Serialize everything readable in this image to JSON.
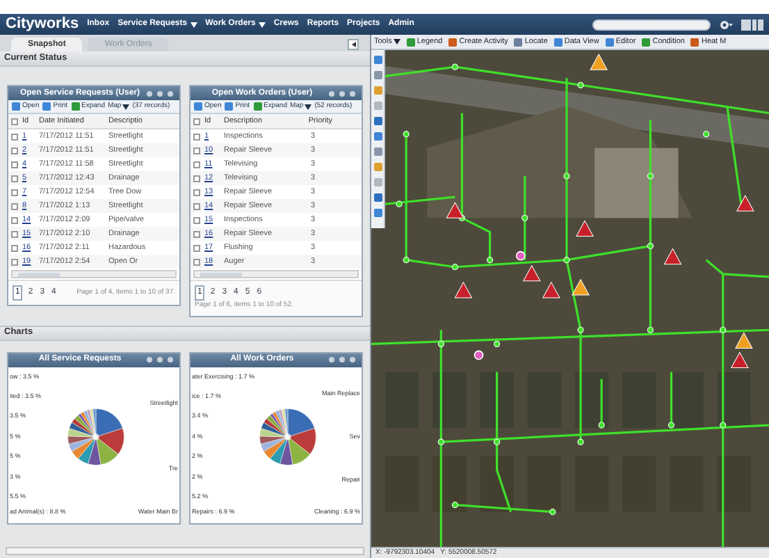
{
  "app": {
    "logo": "Cityworks",
    "nav": [
      {
        "label": "Inbox",
        "dropdown": false
      },
      {
        "label": "Service Requests",
        "dropdown": true
      },
      {
        "label": "Work Orders",
        "dropdown": true
      },
      {
        "label": "Crews",
        "dropdown": false
      },
      {
        "label": "Reports",
        "dropdown": false
      },
      {
        "label": "Projects",
        "dropdown": false
      },
      {
        "label": "Admin",
        "dropdown": false
      }
    ]
  },
  "tabs": [
    {
      "label": "Snapshot",
      "selected": true
    },
    {
      "label": "Work Orders",
      "selected": false
    }
  ],
  "current_status": {
    "title": "Current Status",
    "widgets": [
      {
        "title": "Open Service Requests (User)",
        "header_checked": false,
        "toolbar": [
          "Open",
          "Print",
          "Expand",
          "Map"
        ],
        "records": "(37 records)",
        "columns": [
          "Id",
          "Date Initiated",
          "Descriptio"
        ],
        "rows": [
          {
            "checked": false,
            "cells": [
              "1",
              "7/17/2012 11:51",
              "Streetlight"
            ]
          },
          {
            "checked": false,
            "cells": [
              "2",
              "7/17/2012 11:51",
              "Streetlight"
            ]
          },
          {
            "checked": false,
            "cells": [
              "4",
              "7/17/2012 11:58",
              "Streetlight"
            ]
          },
          {
            "checked": false,
            "cells": [
              "5",
              "7/17/2012 12:43",
              "Drainage"
            ]
          },
          {
            "checked": false,
            "cells": [
              "7",
              "7/17/2012 12:54",
              "Tree Dow"
            ]
          },
          {
            "checked": false,
            "cells": [
              "8",
              "7/17/2012 1:13",
              "Streetlight"
            ]
          },
          {
            "checked": false,
            "cells": [
              "14",
              "7/17/2012 2:09",
              "Pipe/valve"
            ]
          },
          {
            "checked": false,
            "cells": [
              "15",
              "7/17/2012 2:10",
              "Drainage"
            ]
          },
          {
            "checked": false,
            "cells": [
              "16",
              "7/17/2012 2:11",
              "Hazardous"
            ]
          },
          {
            "checked": false,
            "cells": [
              "19",
              "7/17/2012 2:54",
              "Open Or"
            ]
          }
        ],
        "pages": [
          {
            "label": "1",
            "selected": true
          },
          {
            "label": "2",
            "selected": false
          },
          {
            "label": "3",
            "selected": false
          },
          {
            "label": "4",
            "selected": false
          }
        ],
        "page_info": "Page 1 of 4, items 1 to 10 of 37."
      },
      {
        "title": "Open Work Orders (User)",
        "header_checked": false,
        "toolbar": [
          "Open",
          "Print",
          "Expand",
          "Map"
        ],
        "records": "(52 records)",
        "columns": [
          "Id",
          "Description",
          "Priority"
        ],
        "rows": [
          {
            "checked": false,
            "cells": [
              "1",
              "Inspections",
              "3"
            ]
          },
          {
            "checked": false,
            "cells": [
              "10",
              "Repair Sleeve",
              "3"
            ]
          },
          {
            "checked": false,
            "cells": [
              "11",
              "Televising",
              "3"
            ]
          },
          {
            "checked": false,
            "cells": [
              "12",
              "Televising",
              "3"
            ]
          },
          {
            "checked": false,
            "cells": [
              "13",
              "Repair Sleeve",
              "3"
            ]
          },
          {
            "checked": false,
            "cells": [
              "14",
              "Repair Sleeve",
              "3"
            ]
          },
          {
            "checked": false,
            "cells": [
              "15",
              "Inspections",
              "3"
            ]
          },
          {
            "checked": false,
            "cells": [
              "16",
              "Repair Sleeve",
              "3"
            ]
          },
          {
            "checked": false,
            "cells": [
              "17",
              "Flushing",
              "3"
            ]
          },
          {
            "checked": false,
            "cells": [
              "18",
              "Auger",
              "3"
            ]
          }
        ],
        "pages": [
          {
            "label": "1",
            "selected": true
          },
          {
            "label": "2",
            "selected": false
          },
          {
            "label": "3",
            "selected": false
          },
          {
            "label": "4",
            "selected": false
          },
          {
            "label": "5",
            "selected": false
          },
          {
            "label": "6",
            "selected": false
          }
        ],
        "page_info": "Page 1 of 6, items 1 to 10 of 52."
      }
    ]
  },
  "charts": {
    "title": "Charts",
    "panels": [
      {
        "title": "All Service Requests",
        "left_labels": [
          "ow : 3.5 %",
          "ited : 3.5 %",
          "3.5 %",
          "5 %",
          "5 %",
          "3 %",
          "5.5 %",
          "ad Animal(s) : 8.8 %"
        ],
        "right_labels": [
          "Streetlight",
          "Tre",
          "Water Main Br"
        ]
      },
      {
        "title": "All Work Orders",
        "left_labels": [
          "ater Exercising : 1.7 %",
          "ice : 1.7 %",
          "3.4 %",
          "4 %",
          "2 %",
          "2 %",
          "5.2 %",
          "Repairs : 6.9 %"
        ],
        "right_labels": [
          "Main Replace",
          "Sev",
          "Repair",
          "Cleaning : 6.9 %"
        ]
      }
    ]
  },
  "map": {
    "toolbar": [
      "Tools",
      "Legend",
      "Create Activity",
      "Locate",
      "Data View",
      "Editor",
      "Condition",
      "Heat M"
    ],
    "status": "X: -9792303.10404   Y: 5520008.50572"
  }
}
